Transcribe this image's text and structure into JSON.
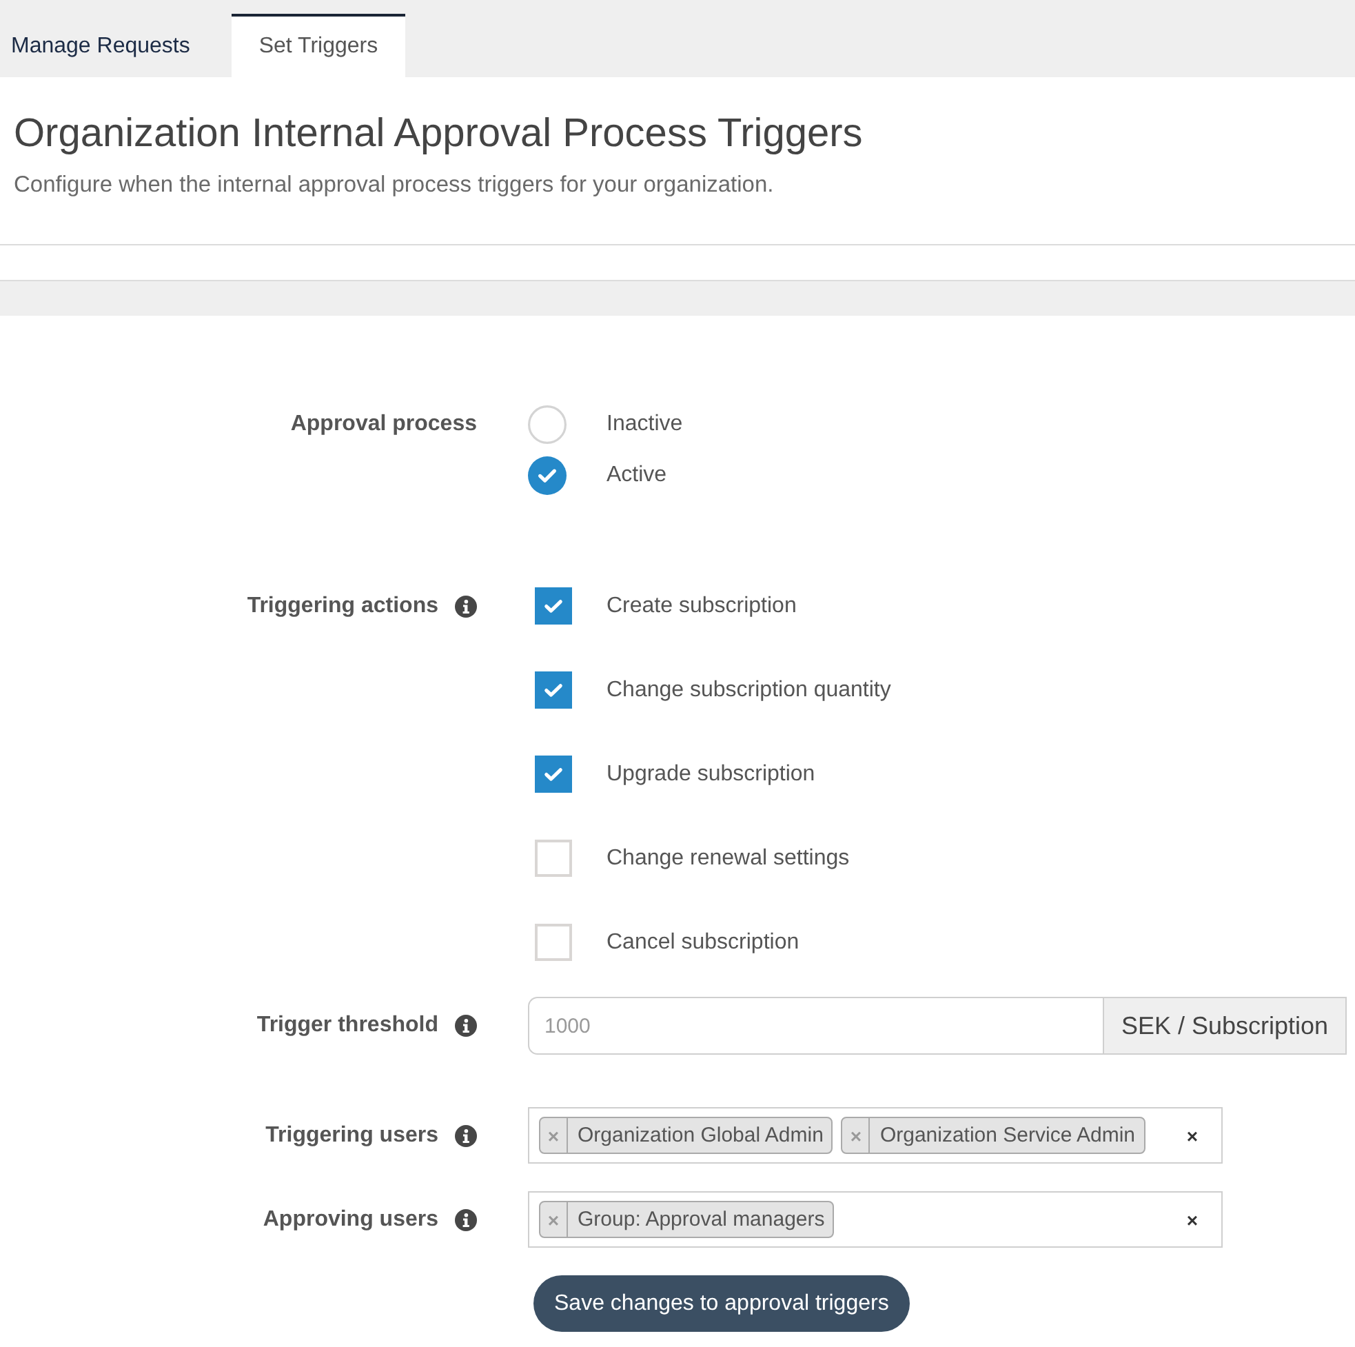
{
  "tabs": [
    {
      "label": "Manage Requests",
      "selected": false
    },
    {
      "label": "Set Triggers",
      "selected": true
    }
  ],
  "header": {
    "title": "Organization Internal Approval Process Triggers",
    "subtitle": "Configure when the internal approval process triggers for your organization."
  },
  "form": {
    "rows": [
      {
        "kind": "radio",
        "label": "Approval process",
        "info_icon": false,
        "options": [
          {
            "label": "Inactive",
            "selected": false
          },
          {
            "label": "Active",
            "selected": true
          }
        ]
      },
      {
        "kind": "checkboxes",
        "label": "Triggering actions",
        "info_icon": true,
        "options": [
          {
            "label": "Create subscription",
            "checked": true
          },
          {
            "label": "Change subscription quantity",
            "checked": true
          },
          {
            "label": "Upgrade subscription",
            "checked": true
          },
          {
            "label": "Change renewal settings",
            "checked": false
          },
          {
            "label": "Cancel subscription",
            "checked": false
          }
        ]
      },
      {
        "kind": "amount",
        "label": "Trigger threshold",
        "info_icon": true,
        "placeholder": "1000",
        "unit": "SEK / Subscription"
      },
      {
        "kind": "tags",
        "label": "Triggering users",
        "info_icon": true,
        "tags": [
          {
            "remove": "×",
            "label": "Organization Global Admin"
          },
          {
            "remove": "×",
            "label": "Organization Service Admin"
          }
        ],
        "clear": "×"
      },
      {
        "kind": "tags",
        "label": "Approving users",
        "info_icon": true,
        "tags": [
          {
            "remove": "×",
            "label": "Group: Approval managers"
          }
        ],
        "clear": "×"
      }
    ],
    "submit": {
      "label": "Save changes to approval triggers"
    }
  }
}
